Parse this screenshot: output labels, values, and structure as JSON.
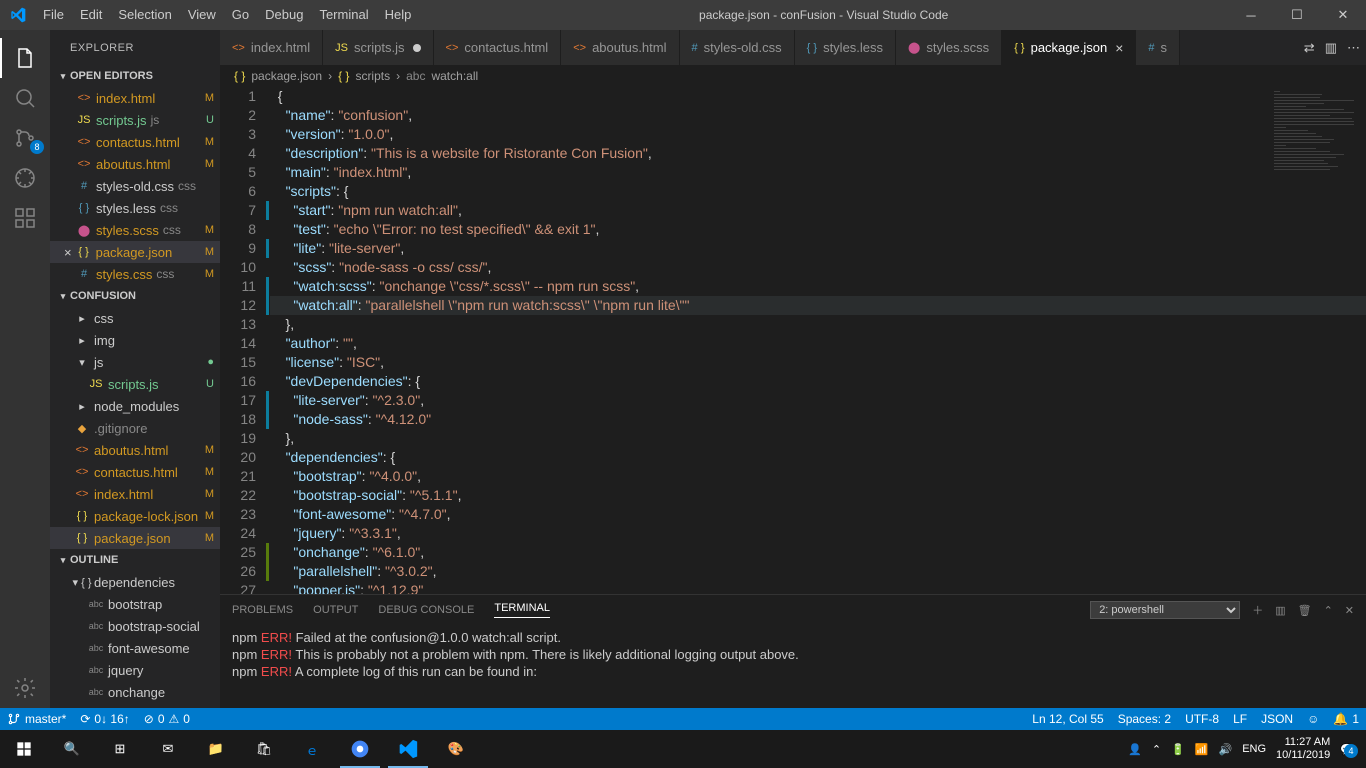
{
  "title": "package.json - conFusion - Visual Studio Code",
  "menu": [
    "File",
    "Edit",
    "Selection",
    "View",
    "Go",
    "Debug",
    "Terminal",
    "Help"
  ],
  "activitybar": {
    "scm_badge": "8"
  },
  "sidebar": {
    "title": "EXPLORER",
    "sections": {
      "open_editors": "OPEN EDITORS",
      "project": "CONFUSION",
      "outline": "OUTLINE"
    },
    "open_editors": [
      {
        "name": "index.html",
        "status": "M",
        "icon": "html",
        "mod": true
      },
      {
        "name": "scripts.js",
        "ext": "js",
        "status": "U",
        "icon": "js",
        "unt": true
      },
      {
        "name": "contactus.html",
        "status": "M",
        "icon": "html",
        "mod": true
      },
      {
        "name": "aboutus.html",
        "status": "M",
        "icon": "html",
        "mod": true
      },
      {
        "name": "styles-old.css",
        "ext": "css",
        "icon": "css"
      },
      {
        "name": "styles.less",
        "ext": "css",
        "icon": "less"
      },
      {
        "name": "styles.scss",
        "ext": "css",
        "status": "M",
        "icon": "scss",
        "mod": true
      },
      {
        "name": "package.json",
        "status": "M",
        "icon": "json",
        "mod": true,
        "active": true,
        "close": true
      },
      {
        "name": "styles.css",
        "ext": "css",
        "status": "M",
        "icon": "css",
        "mod": true
      }
    ],
    "tree": [
      {
        "name": "css",
        "kind": "folder",
        "indent": 1
      },
      {
        "name": "img",
        "kind": "folder",
        "indent": 1
      },
      {
        "name": "js",
        "kind": "folder",
        "indent": 1,
        "open": true,
        "dot": true
      },
      {
        "name": "scripts.js",
        "kind": "file",
        "icon": "js",
        "indent": 2,
        "status": "U",
        "unt": true
      },
      {
        "name": "node_modules",
        "kind": "folder",
        "indent": 1
      },
      {
        "name": ".gitignore",
        "kind": "file",
        "icon": "git",
        "indent": 1,
        "dim": true
      },
      {
        "name": "aboutus.html",
        "kind": "file",
        "icon": "html",
        "indent": 1,
        "status": "M",
        "mod": true
      },
      {
        "name": "contactus.html",
        "kind": "file",
        "icon": "html",
        "indent": 1,
        "status": "M",
        "mod": true
      },
      {
        "name": "index.html",
        "kind": "file",
        "icon": "html",
        "indent": 1,
        "status": "M",
        "mod": true
      },
      {
        "name": "package-lock.json",
        "kind": "file",
        "icon": "json",
        "indent": 1,
        "status": "M",
        "mod": true
      },
      {
        "name": "package.json",
        "kind": "file",
        "icon": "json",
        "indent": 1,
        "status": "M",
        "mod": true,
        "active": true
      }
    ],
    "outline": [
      {
        "name": "dependencies",
        "kind": "obj",
        "indent": 1
      },
      {
        "name": "bootstrap",
        "kind": "str",
        "indent": 2
      },
      {
        "name": "bootstrap-social",
        "kind": "str",
        "indent": 2
      },
      {
        "name": "font-awesome",
        "kind": "str",
        "indent": 2
      },
      {
        "name": "jquery",
        "kind": "str",
        "indent": 2
      },
      {
        "name": "onchange",
        "kind": "str",
        "indent": 2
      }
    ]
  },
  "tabs": [
    {
      "name": "index.html",
      "icon": "html"
    },
    {
      "name": "scripts.js",
      "icon": "js",
      "dot": true
    },
    {
      "name": "contactus.html",
      "icon": "html"
    },
    {
      "name": "aboutus.html",
      "icon": "html"
    },
    {
      "name": "styles-old.css",
      "icon": "css"
    },
    {
      "name": "styles.less",
      "icon": "less"
    },
    {
      "name": "styles.scss",
      "icon": "scss"
    },
    {
      "name": "package.json",
      "icon": "json",
      "active": true,
      "close": true
    },
    {
      "name": "s",
      "icon": "css"
    }
  ],
  "breadcrumb": [
    "package.json",
    "scripts",
    "watch:all"
  ],
  "code": {
    "lines": [
      {
        "n": 1,
        "t": "  {"
      },
      {
        "n": 2,
        "t": "    \"name\": \"confusion\","
      },
      {
        "n": 3,
        "t": "    \"version\": \"1.0.0\","
      },
      {
        "n": 4,
        "t": "    \"description\": \"This is a website for Ristorante Con Fusion\","
      },
      {
        "n": 5,
        "t": "    \"main\": \"index.html\","
      },
      {
        "n": 6,
        "t": "    \"scripts\": {"
      },
      {
        "n": 7,
        "t": "      \"start\": \"npm run watch:all\",",
        "bar": "mod"
      },
      {
        "n": 8,
        "t": "      \"test\": \"echo \\\"Error: no test specified\\\" && exit 1\","
      },
      {
        "n": 9,
        "t": "      \"lite\": \"lite-server\",",
        "bar": "mod"
      },
      {
        "n": 10,
        "t": "      \"scss\": \"node-sass -o css/ css/\","
      },
      {
        "n": 11,
        "t": "      \"watch:scss\": \"onchange \\\"css/*.scss\\\" -- npm run scss\",",
        "bar": "mod"
      },
      {
        "n": 12,
        "t": "      \"watch:all\": \"parallelshell \\\"npm run watch:scss\\\" \\\"npm run lite\\\"\"",
        "bar": "mod",
        "cur": true
      },
      {
        "n": 13,
        "t": "    },"
      },
      {
        "n": 14,
        "t": "    \"author\": \"\","
      },
      {
        "n": 15,
        "t": "    \"license\": \"ISC\","
      },
      {
        "n": 16,
        "t": "    \"devDependencies\": {"
      },
      {
        "n": 17,
        "t": "      \"lite-server\": \"^2.3.0\",",
        "bar": "mod"
      },
      {
        "n": 18,
        "t": "      \"node-sass\": \"^4.12.0\"",
        "bar": "mod"
      },
      {
        "n": 19,
        "t": "    },"
      },
      {
        "n": 20,
        "t": "    \"dependencies\": {"
      },
      {
        "n": 21,
        "t": "      \"bootstrap\": \"^4.0.0\","
      },
      {
        "n": 22,
        "t": "      \"bootstrap-social\": \"^5.1.1\","
      },
      {
        "n": 23,
        "t": "      \"font-awesome\": \"^4.7.0\","
      },
      {
        "n": 24,
        "t": "      \"jquery\": \"^3.3.1\","
      },
      {
        "n": 25,
        "t": "      \"onchange\": \"^6.1.0\",",
        "bar": "add"
      },
      {
        "n": 26,
        "t": "      \"parallelshell\": \"^3.0.2\",",
        "bar": "add"
      },
      {
        "n": 27,
        "t": "      \"popper.js\": \"^1.12.9\""
      }
    ]
  },
  "terminal": {
    "tabs": [
      "PROBLEMS",
      "OUTPUT",
      "DEBUG CONSOLE",
      "TERMINAL"
    ],
    "select": "2: powershell",
    "lines": [
      {
        "pre": "npm ",
        "err": "ERR!",
        "post": " Failed at the confusion@1.0.0 watch:all script."
      },
      {
        "pre": "npm ",
        "err": "ERR!",
        "post": " This is probably not a problem with npm. There is likely additional logging output above."
      },
      {
        "pre": "",
        "err": "",
        "post": ""
      },
      {
        "pre": "npm ",
        "err": "ERR!",
        "post": " A complete log of this run can be found in:"
      }
    ]
  },
  "statusbar": {
    "branch": "master*",
    "sync": "0↓ 16↑",
    "errors": "0",
    "warnings": "0",
    "pos": "Ln 12, Col 55",
    "spaces": "Spaces: 2",
    "enc": "UTF-8",
    "eol": "LF",
    "lang": "JSON",
    "bell": "1"
  },
  "taskbar": {
    "time": "11:27 AM",
    "date": "10/11/2019",
    "lang": "ENG",
    "notif": "4"
  }
}
